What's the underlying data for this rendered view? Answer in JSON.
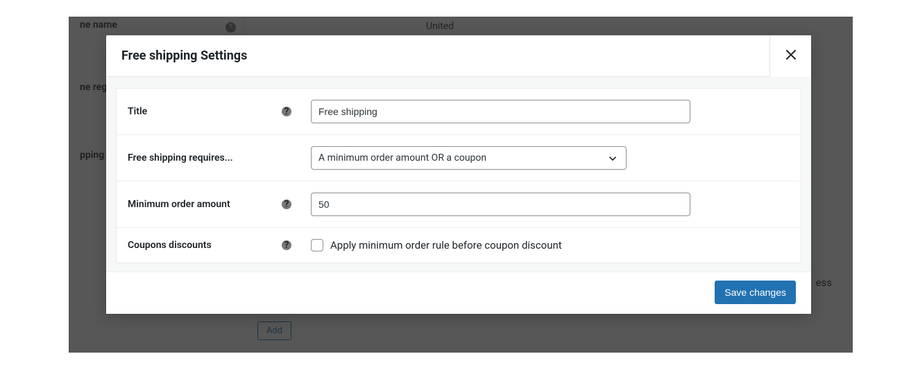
{
  "bg": {
    "zone_name_label": "ne name",
    "zone_name_value": "United",
    "zone_regions_label": "ne reg",
    "shipping_label": "pping",
    "bottom_right_text": "ess",
    "add_button": "Add"
  },
  "modal": {
    "title": "Free shipping Settings",
    "rows": {
      "title": {
        "label": "Title",
        "value": "Free shipping"
      },
      "requires": {
        "label": "Free shipping requires...",
        "selected": "A minimum order amount OR a coupon"
      },
      "minimum": {
        "label": "Minimum order amount",
        "value": "50"
      },
      "coupons": {
        "label": "Coupons discounts",
        "checkbox_label": "Apply minimum order rule before coupon discount",
        "checked": false
      }
    },
    "save_label": "Save changes"
  }
}
